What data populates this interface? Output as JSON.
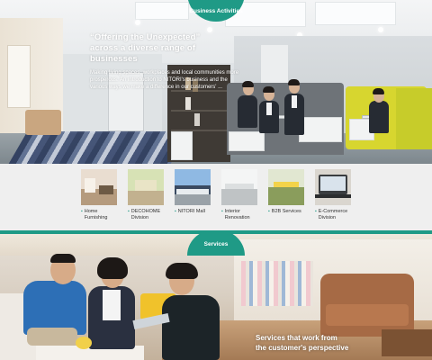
{
  "business": {
    "badge": "Business Activities",
    "heading_line1": "“Offering the Unexpected”",
    "heading_line2": "across a diverse range of businesses",
    "body": "Making living spaces, workplaces and local communities more prosperous. An introduction to NITORI's business and the various ways we make a difference in our customers' ..."
  },
  "nav": {
    "items": [
      {
        "label": "Home\nFurnishing",
        "icon": "home-furnishing-thumbnail"
      },
      {
        "label": "DECOHOME\nDivision",
        "icon": "decohome-thumbnail"
      },
      {
        "label": "NITORI Mall",
        "icon": "nitori-mall-thumbnail"
      },
      {
        "label": "Interior\nRenovation",
        "icon": "interior-renovation-thumbnail"
      },
      {
        "label": "B2B Services",
        "icon": "b2b-services-thumbnail"
      },
      {
        "label": "E-Commerce\nDivision",
        "icon": "e-commerce-thumbnail"
      }
    ]
  },
  "services": {
    "badge": "Services",
    "caption_line1": "Services that work from",
    "caption_line2": "the customer's perspective"
  },
  "colors": {
    "accent": "#1f9a86",
    "nav_bg": "#efefef"
  }
}
